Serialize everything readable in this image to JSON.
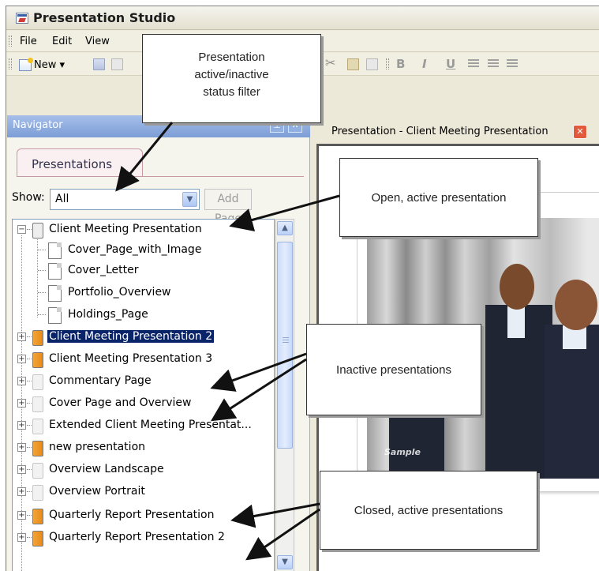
{
  "app": {
    "title": "Presentation Studio"
  },
  "menu": [
    "File",
    "Edit",
    "View"
  ],
  "toolbar": {
    "new_label": "New ▾",
    "bold": "B",
    "italic": "I",
    "underline": "U"
  },
  "navigator": {
    "title": "Navigator",
    "pin_icon": "pin-icon",
    "close_icon": "close-icon",
    "tab": "Presentations",
    "show_label": "Show:",
    "show_value": "All",
    "add_page": "Add Page",
    "tree": [
      {
        "label": "Client Meeting Presentation",
        "state": "open",
        "expanded": true
      },
      {
        "label": "Cover_Page_with_Image",
        "child": true
      },
      {
        "label": "Cover_Letter",
        "child": true
      },
      {
        "label": "Portfolio_Overview",
        "child": true
      },
      {
        "label": "Holdings_Page",
        "child": true
      },
      {
        "label": "Client Meeting Presentation 2",
        "state": "active",
        "selected": true
      },
      {
        "label": "Client Meeting Presentation 3",
        "state": "active"
      },
      {
        "label": "Commentary Page",
        "state": "inactive"
      },
      {
        "label": "Cover Page and Overview",
        "state": "inactive"
      },
      {
        "label": "Extended Client Meeting Presentat...",
        "state": "inactive"
      },
      {
        "label": "new presentation",
        "state": "active"
      },
      {
        "label": "Overview Landscape",
        "state": "inactive"
      },
      {
        "label": "Overview Portrait",
        "state": "inactive"
      },
      {
        "label": "Quarterly Report Presentation",
        "state": "active"
      },
      {
        "label": "Quarterly Report Presentation 2",
        "state": "active"
      }
    ]
  },
  "document_tab": {
    "title": "Presentation - Client Meeting Presentation",
    "close_icon": "close-icon"
  },
  "slide": {
    "watermark": "Sample"
  },
  "callouts": {
    "status_filter": [
      "Presentation",
      "active/inactive",
      "status filter"
    ],
    "open_active": "Open, active presentation",
    "inactive": "Inactive presentations",
    "closed_active": "Closed, active presentations"
  },
  "colors": {
    "selection": "#0a246a",
    "nav_header": "#7d9dd6",
    "active_icon": "#e78a15",
    "close_button": "#e05a3b"
  }
}
